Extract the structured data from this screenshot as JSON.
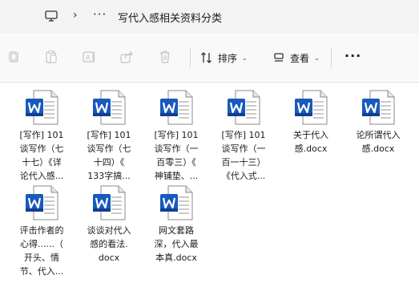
{
  "address": {
    "separator": "›",
    "overflow": "···",
    "current_folder": "写代入感相关资料分类"
  },
  "toolbar": {
    "sort_label": "排序",
    "view_label": "查看",
    "more_label": "···"
  },
  "files": [
    {
      "name": "[写作] 101\n谈写作（七\n十七）《详\n论代入感..."
    },
    {
      "name": "[写作] 101\n谈写作（七\n十四）《\n133字搞..."
    },
    {
      "name": "[写作] 101\n谈写作（一\n百零三）《\n神铺垫、..."
    },
    {
      "name": "[写作] 101\n谈写作（一\n百一十三）\n《代入式..."
    },
    {
      "name": "关于代入\n感.docx"
    },
    {
      "name": "论所谓代入\n感.docx"
    },
    {
      "name": "评击作者的\n心得......（\n开头、情\n节、代入..."
    },
    {
      "name": "谈谈对代入\n感的看法.\ndocx"
    },
    {
      "name": "网文套路\n深，代入最\n本真.docx"
    }
  ],
  "colors": {
    "word_blue": "#185abd",
    "word_blue_dark": "#103f91",
    "toolbar_bg": "#f9f9f9",
    "address_bg": "#f3f3f3"
  }
}
